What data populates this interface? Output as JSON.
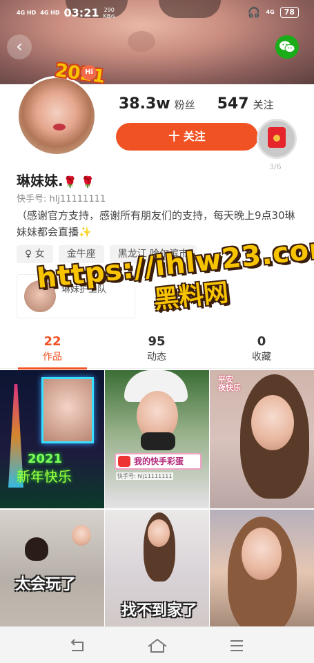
{
  "status_bar": {
    "signal_1": "4G HD",
    "signal_2": "4G HD",
    "time": "03:21",
    "speed_value": "290",
    "speed_unit": "KB/s",
    "net_right": "4G",
    "battery": "78"
  },
  "header": {
    "back_icon": "chevron-left-icon",
    "share_icon": "wechat-icon"
  },
  "profile": {
    "avatar_badge": "2021",
    "avatar_badge_hi": "Hi",
    "followers_count": "38.3w",
    "followers_label": "粉丝",
    "following_count": "547",
    "following_label": "关注",
    "follow_button": "十 关注",
    "redpacket_count": "3/6",
    "name": "琳妹妹.",
    "name_emoji": "🌹 🌹",
    "uid": "快手号: hlj11111111",
    "bio": "（感谢官方支持，感谢所有朋友们的支持，每天晚上9点30琳妹妹都会直播✨",
    "tags": [
      "♀ 女",
      "金牛座",
      "黑龙江 哈尔滨市"
    ]
  },
  "mini_card": {
    "name": "琳妹护卫队"
  },
  "watermark": {
    "url": "https://ihlw23.com",
    "site": "黑料网"
  },
  "tabs": [
    {
      "count": "22",
      "label": "作品"
    },
    {
      "count": "95",
      "label": "动态"
    },
    {
      "count": "0",
      "label": "收藏"
    }
  ],
  "grid": {
    "c1_neon_year": "2021",
    "c1_neon_text": "新年快乐",
    "c2_banner": "我的快手彩蛋",
    "c2_uid": "快手号: hlj11111111",
    "c3_text": "平安\n夜快乐",
    "c4_caption": "太会玩了",
    "c5_caption": "找不到家了"
  },
  "colors": {
    "accent": "#f05223",
    "wechat": "#1aad19",
    "watermark": "#f8c300"
  }
}
